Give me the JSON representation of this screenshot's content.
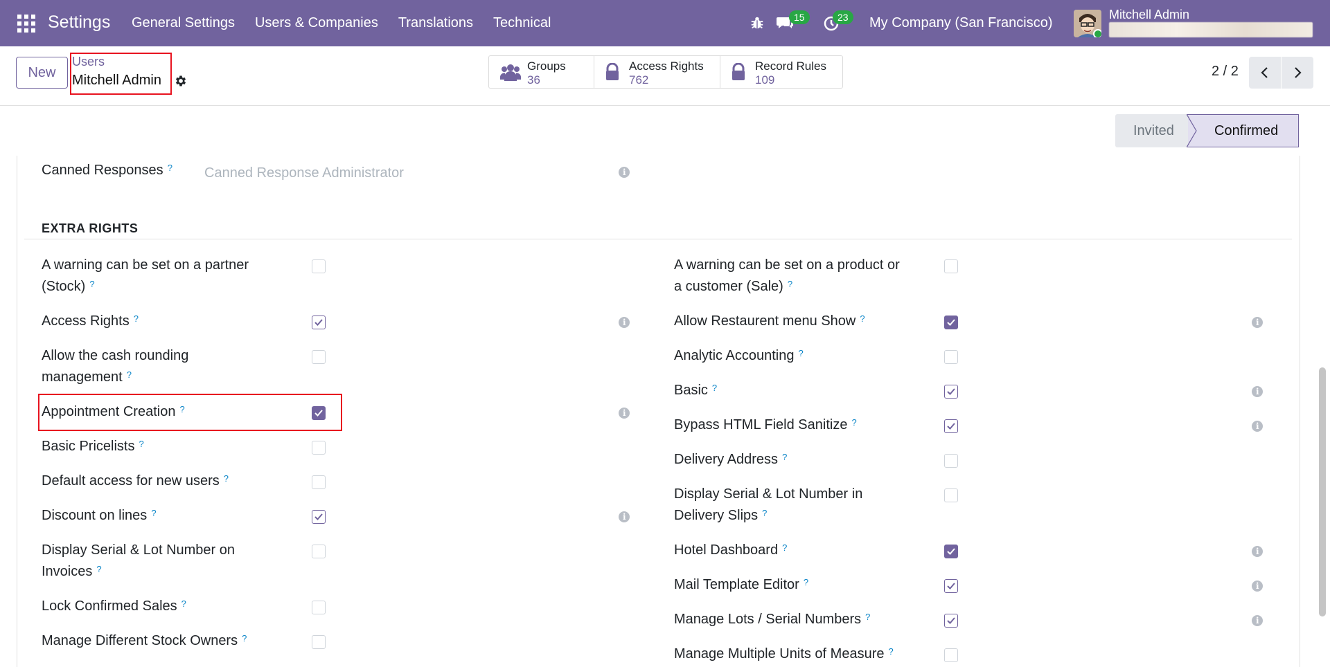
{
  "navbar": {
    "brand": "Settings",
    "menu": [
      "General Settings",
      "Users & Companies",
      "Translations",
      "Technical"
    ],
    "messages_count": "15",
    "activities_count": "23",
    "company": "My Company (San Francisco)",
    "user_name": "Mitchell Admin"
  },
  "control": {
    "new_label": "New",
    "breadcrumb_parent": "Users",
    "breadcrumb_current": "Mitchell Admin",
    "smart_buttons": [
      {
        "label": "Groups",
        "value": "36",
        "icon": "users-icon"
      },
      {
        "label": "Access Rights",
        "value": "762",
        "icon": "lock-icon"
      },
      {
        "label": "Record Rules",
        "value": "109",
        "icon": "lock-icon"
      }
    ],
    "pager": "2 / 2"
  },
  "status": {
    "invited": "Invited",
    "confirmed": "Confirmed"
  },
  "form": {
    "canned": {
      "label": "Canned Responses",
      "placeholder": "Canned Response Administrator"
    },
    "section_title": "EXTRA RIGHTS",
    "left": [
      {
        "label1": "A warning can be set on a partner",
        "label2": "(Stock)",
        "checked": "none"
      },
      {
        "label1": "Access Rights",
        "label2": "",
        "checked": "outline"
      },
      {
        "label1": "Allow the cash rounding",
        "label2": "management",
        "checked": "none"
      },
      {
        "label1": "Appointment Creation",
        "label2": "",
        "checked": "fill"
      },
      {
        "label1": "Basic Pricelists",
        "label2": "",
        "checked": "none"
      },
      {
        "label1": "Default access for new users",
        "label2": "",
        "checked": "none"
      },
      {
        "label1": "Discount on lines",
        "label2": "",
        "checked": "outline"
      },
      {
        "label1": "Display Serial & Lot Number on",
        "label2": "Invoices",
        "checked": "none"
      },
      {
        "label1": "Lock Confirmed Sales",
        "label2": "",
        "checked": "none"
      },
      {
        "label1": "Manage Different Stock Owners",
        "label2": "",
        "checked": "none"
      }
    ],
    "right": [
      {
        "label1": "A warning can be set on a product or",
        "label2": "a customer (Sale)",
        "checked": "none"
      },
      {
        "label1": "Allow Restaurent menu Show",
        "label2": "",
        "checked": "fill"
      },
      {
        "label1": "Analytic Accounting",
        "label2": "",
        "checked": "none"
      },
      {
        "label1": "Basic",
        "label2": "",
        "checked": "outline"
      },
      {
        "label1": "Bypass HTML Field Sanitize",
        "label2": "",
        "checked": "outline"
      },
      {
        "label1": "Delivery Address",
        "label2": "",
        "checked": "none"
      },
      {
        "label1": "Display Serial & Lot Number in",
        "label2": "Delivery Slips",
        "checked": "none"
      },
      {
        "label1": "Hotel Dashboard",
        "label2": "",
        "checked": "fill"
      },
      {
        "label1": "Mail Template Editor",
        "label2": "",
        "checked": "outline"
      },
      {
        "label1": "Manage Lots / Serial Numbers",
        "label2": "",
        "checked": "outline"
      },
      {
        "label1": "Manage Multiple Units of Measure",
        "label2": "",
        "checked": "none"
      }
    ]
  },
  "colors": {
    "brand": "#71639e",
    "highlight": "#e8131f",
    "help": "#0d86c8"
  }
}
